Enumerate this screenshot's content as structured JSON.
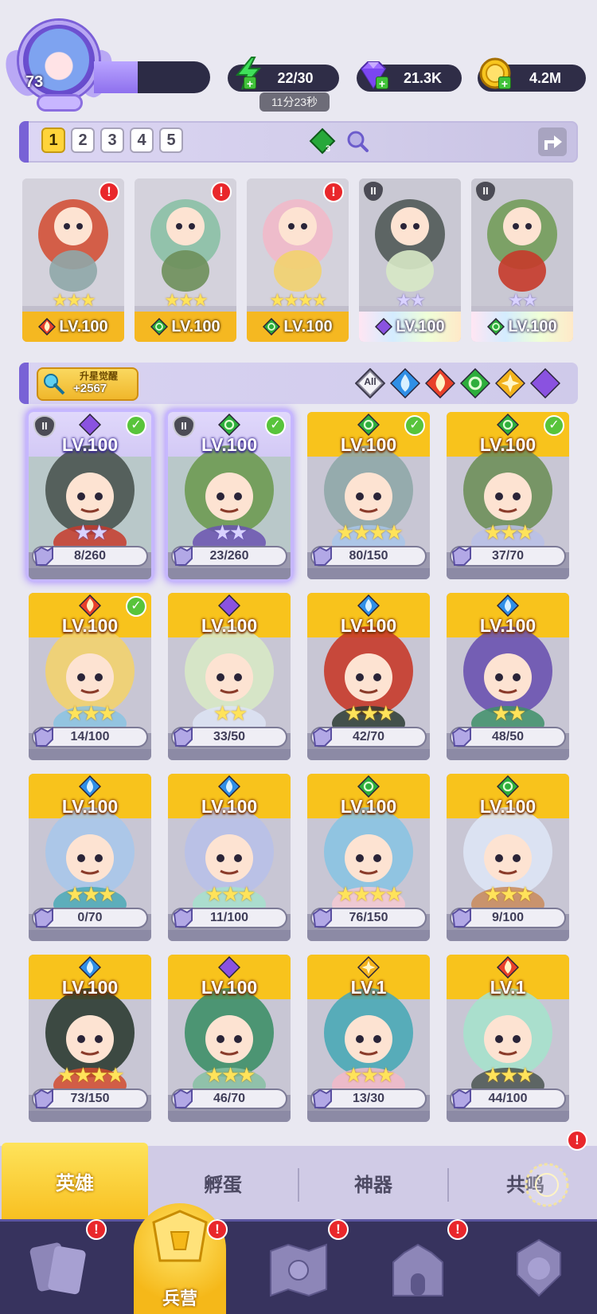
{
  "player": {
    "level": "73",
    "xp_fraction": 0.38
  },
  "resources": {
    "energy": {
      "value": "22/30",
      "timer": "11分23秒",
      "icon": "lightning-icon"
    },
    "gems": {
      "value": "21.3K",
      "icon": "gem-icon"
    },
    "gold": {
      "value": "4.2M",
      "icon": "gold-coin-icon"
    }
  },
  "team_tabs": [
    "1",
    "2",
    "3",
    "4",
    "5"
  ],
  "team_active": "1",
  "team_element_badge": "3",
  "team": [
    {
      "level": "LV.100",
      "element": "fire",
      "stars": 3,
      "star_color": "gold",
      "alert": "!"
    },
    {
      "level": "LV.100",
      "element": "nature",
      "stars": 3,
      "star_color": "gold",
      "alert": "!"
    },
    {
      "level": "LV.100",
      "element": "nature",
      "stars": 4,
      "star_color": "gold",
      "alert": "!"
    },
    {
      "level": "LV.100",
      "element": "dark",
      "stars": 2,
      "star_color": "purple",
      "tier": "II"
    },
    {
      "level": "LV.100",
      "element": "nature",
      "stars": 2,
      "star_color": "purple",
      "tier": "II"
    }
  ],
  "awaken": {
    "label": "升星觉醒",
    "value": "+2567"
  },
  "filters": [
    {
      "name": "all",
      "label": "All"
    },
    {
      "name": "water"
    },
    {
      "name": "fire"
    },
    {
      "name": "nature"
    },
    {
      "name": "light"
    },
    {
      "name": "dark"
    }
  ],
  "heroes": [
    {
      "level": "LV.100",
      "element": "dark",
      "progress": "8/260",
      "stars": 2,
      "star_color": "purple",
      "check": true,
      "tier": "II",
      "style": "purple",
      "selected": true
    },
    {
      "level": "LV.100",
      "element": "nature",
      "progress": "23/260",
      "stars": 2,
      "star_color": "purple",
      "check": true,
      "tier": "II",
      "style": "purple",
      "selected": true
    },
    {
      "level": "LV.100",
      "element": "nature",
      "progress": "80/150",
      "stars": 4,
      "star_color": "gold",
      "check": true,
      "style": "gold"
    },
    {
      "level": "LV.100",
      "element": "nature",
      "progress": "37/70",
      "stars": 3,
      "star_color": "gold",
      "check": true,
      "style": "gold"
    },
    {
      "level": "LV.100",
      "element": "fire",
      "progress": "14/100",
      "stars": 3,
      "star_color": "gold",
      "check": true,
      "style": "gold"
    },
    {
      "level": "LV.100",
      "element": "dark",
      "progress": "33/50",
      "stars": 2,
      "star_color": "gold",
      "style": "gold"
    },
    {
      "level": "LV.100",
      "element": "water",
      "progress": "42/70",
      "stars": 3,
      "star_color": "gold",
      "style": "gold"
    },
    {
      "level": "LV.100",
      "element": "water",
      "progress": "48/50",
      "stars": 2,
      "star_color": "gold",
      "style": "gold"
    },
    {
      "level": "LV.100",
      "element": "water",
      "progress": "0/70",
      "stars": 3,
      "star_color": "gold",
      "style": "gold"
    },
    {
      "level": "LV.100",
      "element": "water",
      "progress": "11/100",
      "stars": 3,
      "star_color": "gold",
      "style": "gold"
    },
    {
      "level": "LV.100",
      "element": "nature",
      "progress": "76/150",
      "stars": 4,
      "star_color": "gold",
      "style": "gold"
    },
    {
      "level": "LV.100",
      "element": "nature",
      "progress": "9/100",
      "stars": 3,
      "star_color": "gold",
      "style": "gold"
    },
    {
      "level": "LV.100",
      "element": "water",
      "progress": "73/150",
      "stars": 4,
      "star_color": "gold",
      "style": "gold"
    },
    {
      "level": "LV.100",
      "element": "dark",
      "progress": "46/70",
      "stars": 3,
      "star_color": "gold",
      "style": "gold"
    },
    {
      "level": "LV.1",
      "element": "light",
      "progress": "13/30",
      "stars": 3,
      "star_color": "gold",
      "style": "gold"
    },
    {
      "level": "LV.1",
      "element": "fire",
      "progress": "44/100",
      "stars": 3,
      "star_color": "gold",
      "style": "gold"
    }
  ],
  "subtabs": {
    "hero": "英雄",
    "egg": "孵蛋",
    "artifact": "神器",
    "resonance": "共鸣"
  },
  "subtab_resonance_alert": "!",
  "nav": {
    "barracks_label": "兵营",
    "items": [
      {
        "name": "cards",
        "icon": "cards-icon",
        "alert": "!"
      },
      {
        "name": "barracks",
        "icon": "barracks-icon",
        "alert": "!"
      },
      {
        "name": "map",
        "icon": "map-icon",
        "alert": "!"
      },
      {
        "name": "castle",
        "icon": "castle-icon",
        "alert": "!"
      },
      {
        "name": "guild",
        "icon": "guild-icon"
      }
    ]
  },
  "colors": {
    "fire": "#e8412a",
    "water": "#2f8fe6",
    "nature": "#2eae3c",
    "light": "#f2b21c",
    "dark": "#8a52e0",
    "gold_card": "#f8c31c",
    "nav_bg": "#37335e"
  }
}
